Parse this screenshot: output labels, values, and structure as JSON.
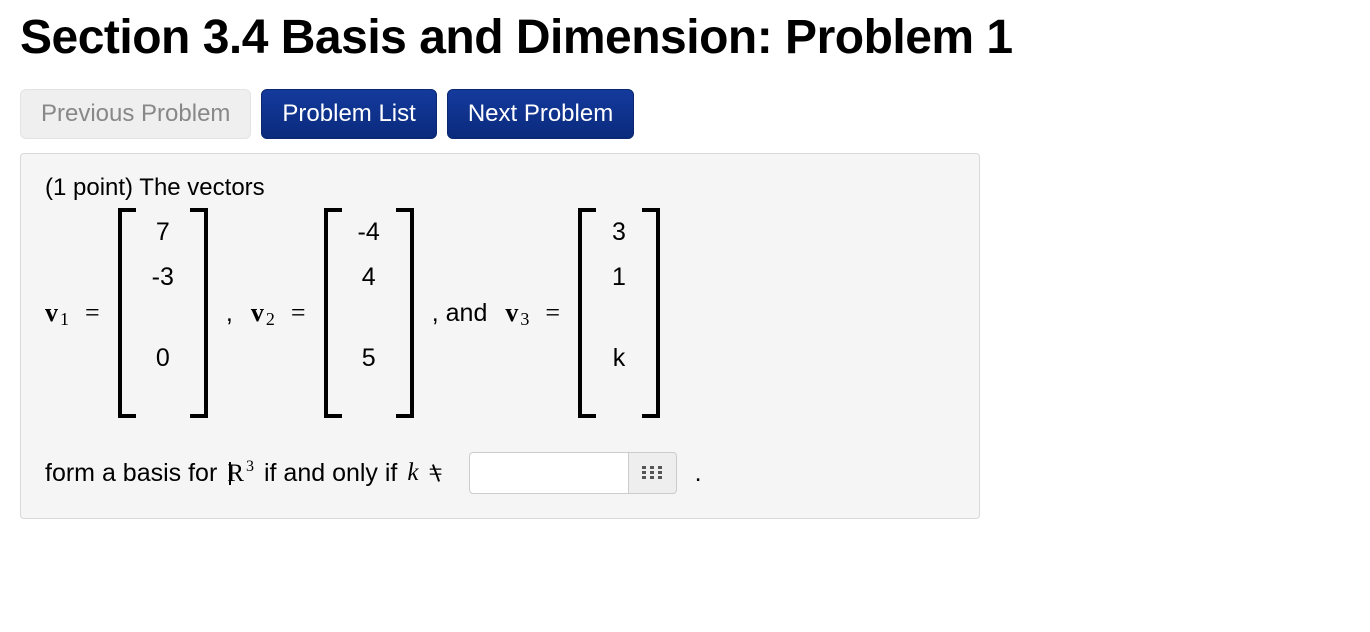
{
  "title": "Section 3.4 Basis and Dimension: Problem 1",
  "nav": {
    "prev": "Previous Problem",
    "list": "Problem List",
    "next": "Next Problem"
  },
  "problem": {
    "points_prefix": "(1 point) The vectors",
    "vectors": {
      "v1": {
        "label": "v",
        "sub": "1",
        "entries": [
          "7",
          "-3",
          "0"
        ]
      },
      "v2": {
        "label": "v",
        "sub": "2",
        "entries": [
          "-4",
          "4",
          "5"
        ]
      },
      "v3": {
        "label": "v",
        "sub": "3",
        "entries": [
          "3",
          "1",
          "k"
        ]
      }
    },
    "sep_comma": ",",
    "sep_and": ", and",
    "eq": "=",
    "bottom_pre": "form a basis for",
    "bottom_mid": "if and only if",
    "k_var": "k",
    "neq": "=",
    "sup3": "3",
    "period": "."
  },
  "answer": {
    "value": ""
  }
}
